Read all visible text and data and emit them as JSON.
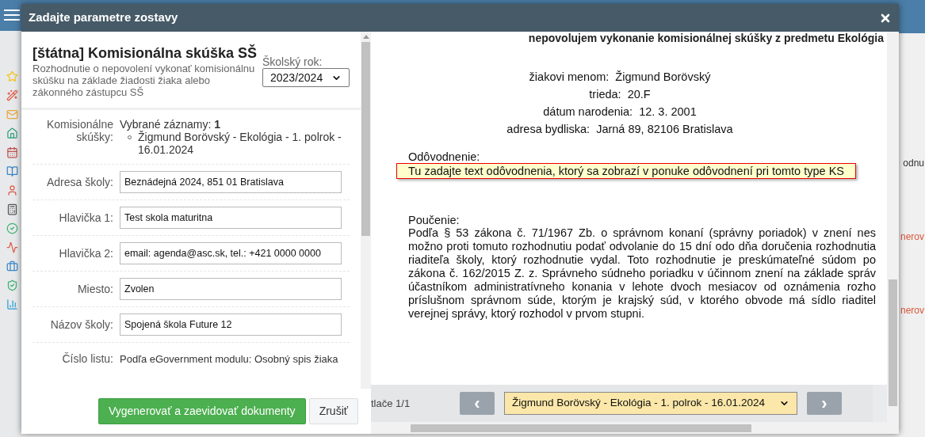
{
  "app": {
    "right_fragments": [
      "odnu",
      "nerov",
      "nerov"
    ]
  },
  "dialog": {
    "title": "Zadajte parametre zostavy"
  },
  "form": {
    "heading": "[štátna] Komisionálna skúška SŠ",
    "description": "Rozhodnutie o nepovolení vykonať komisionálnu skúšku na základe žiadosti žiaka alebo zákonného zástupcu SŠ",
    "year": {
      "label": "Školský rok:",
      "value": "2023/2024"
    },
    "selection": {
      "label": "Komisionálne skúšky:",
      "count_text": "Vybrané záznamy: **1**",
      "items": [
        "Žigmund Borövský - Ekológia - 1. polrok - 16.01.2024"
      ]
    },
    "fields": [
      {
        "label": "Adresa školy:",
        "value": "Beznádejná 2024, 851 01 Bratislava"
      },
      {
        "label": "Hlavička 1:",
        "value": "Test skola maturitna"
      },
      {
        "label": "Hlavička 2:",
        "value": "email: agenda@asc.sk, tel.: +421 0000 0000"
      },
      {
        "label": "Miesto:",
        "value": "Zvolen"
      },
      {
        "label": "Názov školy:",
        "value": "Spojená škola Future 12"
      }
    ],
    "info": {
      "label": "Číslo listu:",
      "value": "Podľa eGovernment modulu: Osobný spis žiaka"
    },
    "buttons": [
      {
        "label": "Vygenerovať a zaevidovať dokumenty",
        "kind": "primary"
      },
      {
        "label": "Zrušiť",
        "kind": "secondary"
      }
    ]
  },
  "preview": {
    "cut_heading": "nepovolujem vykonanie komisionálnej skúšky z predmetu Ekológia",
    "student_details": [
      {
        "label": "žiakovi menom:",
        "value": "Žigmund Borövský"
      },
      {
        "label": "trieda:",
        "value": "20.F"
      },
      {
        "label": "dátum narodenia:",
        "value": "12. 3. 2001"
      },
      {
        "label": "adresa bydliska:",
        "value": "Jarná 89, 82106 Bratislava"
      }
    ],
    "reason": {
      "label": "Odôvodnenie:",
      "hint": "Tu zadajte text odôvodnenia, ktorý sa zobrazí v ponuke odôvodnení pri tomto type KS"
    },
    "instructions": {
      "label": "Poučenie:",
      "lines": [
        "Podľa § 53 zákona č. 71/1967 Zb. o správnom konaní (správny poriadok) v znení nes",
        "možno proti tomuto rozhodnutiu podať odvolanie do 15 dní odo dňa doručenia rozhodnutia",
        "riaditeľa školy, ktorý rozhodnutie vydal. Toto rozhodnutie je preskúmateľné súdom po",
        "zákona č. 162/2015 Z. z. Správneho súdneho poriadku v účinnom znení na základe správ",
        "účastníkom administratívneho konania v lehote dvoch mesiacov od oznámenia rozho",
        "príslušnom správnom súde, ktorým je krajský súd, v ktorého obvode má sídlo riaditel",
        "verejnej správy, ktorý rozhodol v prvom stupni."
      ]
    },
    "pager": {
      "page_text": "tlače 1/1",
      "prev": "‹",
      "next": "›",
      "student": "Žigmund Borövský - Ekológia - 1. polrok - 16.01.2024"
    }
  }
}
